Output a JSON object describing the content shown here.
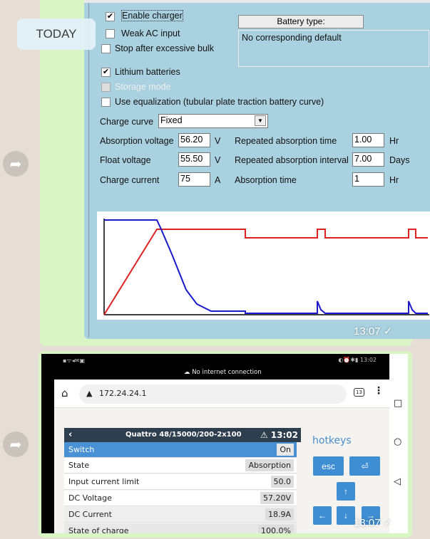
{
  "chat": {
    "date_label": "TODAY",
    "forward_icon": "share-icon"
  },
  "message1": {
    "time": "13:07",
    "checkboxes": [
      {
        "label": "Enable charger",
        "checked": true
      },
      {
        "label": "Weak AC input",
        "checked": false
      },
      {
        "label": "Stop after excessive bulk",
        "checked": false
      },
      {
        "label": "Lithium batteries",
        "checked": true
      },
      {
        "label": "Storage mode",
        "checked": false,
        "disabled": true
      },
      {
        "label": "Use equalization (tubular plate traction battery curve)",
        "checked": false
      }
    ],
    "battery_type_button": "Battery type:",
    "battery_type_text": "No corresponding default",
    "charge_curve_label": "Charge curve",
    "charge_curve_value": "Fixed",
    "fields_left": [
      {
        "label": "Absorption voltage",
        "value": "56.20",
        "unit": "V"
      },
      {
        "label": "Float voltage",
        "value": "55.50",
        "unit": "V"
      },
      {
        "label": "Charge current",
        "value": "75",
        "unit": "A"
      }
    ],
    "fields_right": [
      {
        "label": "Repeated absorption time",
        "value": "1.00",
        "unit": "Hr"
      },
      {
        "label": "Repeated absorption interval",
        "value": "7.00",
        "unit": "Days"
      },
      {
        "label": "Absorption time",
        "value": "1",
        "unit": "Hr"
      }
    ],
    "colors": {
      "voltage": "#dd2222",
      "current": "#1a1acc"
    }
  },
  "message2": {
    "time": "13:07",
    "status_right": "13:02",
    "no_internet": "No internet connection",
    "url": "172.24.24.1",
    "tab_count": "13",
    "device_title": "Quattro 48/15000/200-2x100",
    "device_time": "13:02",
    "rows": [
      {
        "label": "Switch",
        "value": "On",
        "selected": true
      },
      {
        "label": "State",
        "value": "Absorption"
      },
      {
        "label": "Input current limit",
        "value": "50.0"
      },
      {
        "label": "DC Voltage",
        "value": "57.20V"
      },
      {
        "label": "DC Current",
        "value": "18.9A"
      },
      {
        "label": "State of charge",
        "value": "100.0%"
      }
    ],
    "hotkeys_label": "hotkeys",
    "keys": {
      "esc": "esc",
      "enter": "⏎",
      "up": "↑",
      "left": "←",
      "down": "↓",
      "right": "→"
    }
  }
}
